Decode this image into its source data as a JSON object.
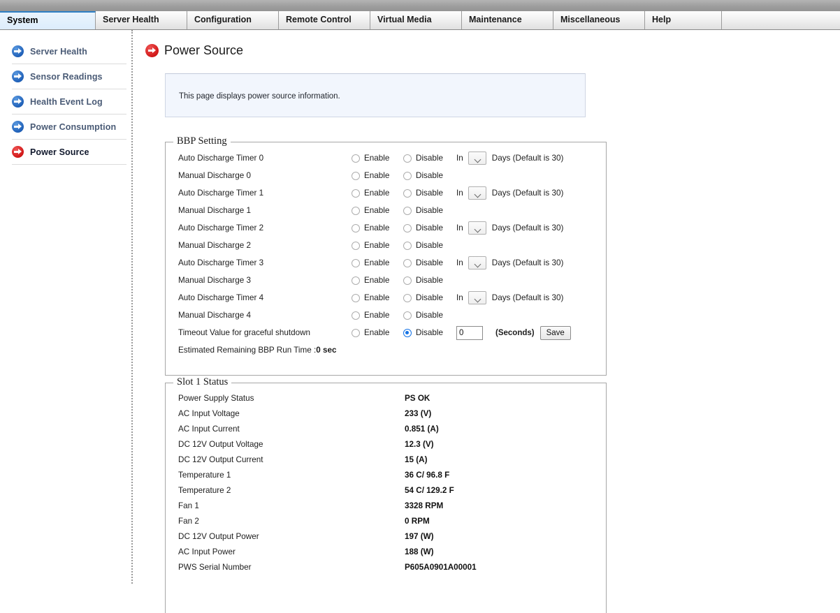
{
  "tabs": [
    {
      "label": "System",
      "active": true
    },
    {
      "label": "Server Health",
      "active": false
    },
    {
      "label": "Configuration",
      "active": false
    },
    {
      "label": "Remote Control",
      "active": false
    },
    {
      "label": "Virtual Media",
      "active": false
    },
    {
      "label": "Maintenance",
      "active": false
    },
    {
      "label": "Miscellaneous",
      "active": false
    },
    {
      "label": "Help",
      "active": false
    }
  ],
  "sidebar": {
    "items": [
      {
        "label": "Server Health",
        "icon": "arrow-circle-icon",
        "active": false
      },
      {
        "label": "Sensor Readings",
        "icon": "arrow-circle-icon",
        "active": false
      },
      {
        "label": "Health Event Log",
        "icon": "arrow-circle-icon",
        "active": false
      },
      {
        "label": "Power Consumption",
        "icon": "arrow-circle-icon",
        "active": false
      },
      {
        "label": "Power Source",
        "icon": "arrow-circle-icon",
        "active": true
      }
    ]
  },
  "page": {
    "title": "Power Source",
    "title_icon": "arrow-circle-icon",
    "info_text": "This page displays power source information."
  },
  "bbp": {
    "legend": "BBP Setting",
    "enable_label": "Enable",
    "disable_label": "Disable",
    "in_label": "In",
    "days_label": "Days (Default is 30)",
    "day_value": "",
    "rows": [
      {
        "label": "Auto Discharge Timer 0",
        "has_days": true,
        "selected": ""
      },
      {
        "label": "Manual Discharge 0",
        "has_days": false,
        "selected": ""
      },
      {
        "label": "Auto Discharge Timer 1",
        "has_days": true,
        "selected": ""
      },
      {
        "label": "Manual Discharge 1",
        "has_days": false,
        "selected": ""
      },
      {
        "label": "Auto Discharge Timer 2",
        "has_days": true,
        "selected": ""
      },
      {
        "label": "Manual Discharge 2",
        "has_days": false,
        "selected": ""
      },
      {
        "label": "Auto Discharge Timer 3",
        "has_days": true,
        "selected": ""
      },
      {
        "label": "Manual Discharge 3",
        "has_days": false,
        "selected": ""
      },
      {
        "label": "Auto Discharge Timer 4",
        "has_days": true,
        "selected": ""
      },
      {
        "label": "Manual Discharge 4",
        "has_days": false,
        "selected": ""
      }
    ],
    "timeout": {
      "label": "Timeout Value for graceful shutdown",
      "enable_label": "Enable",
      "disable_label": "Disable",
      "selected": "disable",
      "value": "0",
      "units_label": "(Seconds)",
      "save_label": "Save"
    },
    "runtime_label": "Estimated Remaining BBP Run Time : ",
    "runtime_value": "0 sec"
  },
  "slot": {
    "legend": "Slot 1 Status",
    "rows": [
      {
        "label": "Power Supply Status",
        "value": "PS OK"
      },
      {
        "label": "AC Input Voltage",
        "value": "233 (V)"
      },
      {
        "label": "AC Input Current",
        "value": "0.851 (A)"
      },
      {
        "label": "DC 12V Output Voltage",
        "value": "12.3 (V)"
      },
      {
        "label": "DC 12V Output Current",
        "value": "15 (A)"
      },
      {
        "label": "Temperature 1",
        "value": "36 C/ 96.8 F"
      },
      {
        "label": "Temperature 2",
        "value": "54 C/ 129.2 F"
      },
      {
        "label": "Fan 1",
        "value": "3328 RPM"
      },
      {
        "label": "Fan 2",
        "value": "0 RPM"
      },
      {
        "label": "DC 12V Output Power",
        "value": "197 (W)"
      },
      {
        "label": "AC Input Power",
        "value": "188 (W)"
      },
      {
        "label": "PWS Serial Number",
        "value": "P605A0901A00001"
      }
    ]
  },
  "colors": {
    "accent_blue": "#1f60b8",
    "accent_red": "#d11717",
    "active_tab_border": "#2e7fc4",
    "info_bg": "#f2f6fd",
    "radio_checked": "#1473e6"
  }
}
